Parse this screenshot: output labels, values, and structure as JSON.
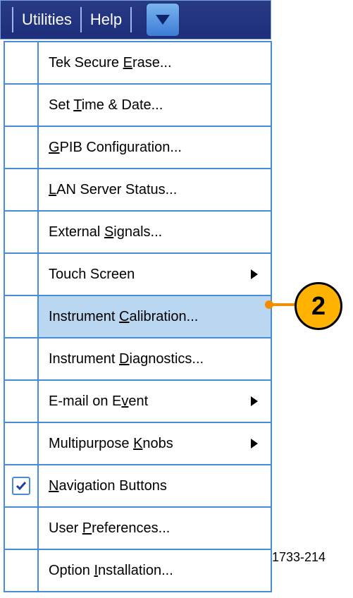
{
  "menubar": {
    "utilities_label": "Utilities",
    "help_label": "Help"
  },
  "menu_items": [
    {
      "id": "tek-secure-erase",
      "parts": [
        "Tek Secure ",
        "E",
        "rase..."
      ],
      "submenu": false,
      "checked": false,
      "highlight": false
    },
    {
      "id": "set-time-date",
      "parts": [
        "Set ",
        "T",
        "ime & Date..."
      ],
      "submenu": false,
      "checked": false,
      "highlight": false
    },
    {
      "id": "gpib-config",
      "parts": [
        "",
        "G",
        "PIB Configuration..."
      ],
      "submenu": false,
      "checked": false,
      "highlight": false
    },
    {
      "id": "lan-server-status",
      "parts": [
        "",
        "L",
        "AN Server Status..."
      ],
      "submenu": false,
      "checked": false,
      "highlight": false
    },
    {
      "id": "external-signals",
      "parts": [
        "External ",
        "S",
        "ignals..."
      ],
      "submenu": false,
      "checked": false,
      "highlight": false
    },
    {
      "id": "touch-screen",
      "parts": [
        "Touch Screen",
        "",
        ""
      ],
      "submenu": true,
      "checked": false,
      "highlight": false
    },
    {
      "id": "instrument-calibration",
      "parts": [
        "Instrument ",
        "C",
        "alibration..."
      ],
      "submenu": false,
      "checked": false,
      "highlight": true
    },
    {
      "id": "instrument-diagnostics",
      "parts": [
        "Instrument ",
        "D",
        "iagnostics..."
      ],
      "submenu": false,
      "checked": false,
      "highlight": false
    },
    {
      "id": "email-on-event",
      "parts": [
        "E-mail on E",
        "v",
        "ent"
      ],
      "submenu": true,
      "checked": false,
      "highlight": false
    },
    {
      "id": "multipurpose-knobs",
      "parts": [
        "Multipurpose ",
        "K",
        "nobs"
      ],
      "submenu": true,
      "checked": false,
      "highlight": false
    },
    {
      "id": "navigation-buttons",
      "parts": [
        "",
        "N",
        "avigation Buttons"
      ],
      "submenu": false,
      "checked": true,
      "highlight": false
    },
    {
      "id": "user-preferences",
      "parts": [
        "User ",
        "P",
        "references..."
      ],
      "submenu": false,
      "checked": false,
      "highlight": false
    },
    {
      "id": "option-installation",
      "parts": [
        "Option ",
        "I",
        "nstallation..."
      ],
      "submenu": false,
      "checked": false,
      "highlight": false
    }
  ],
  "callout": {
    "number": "2"
  },
  "figure_id": "1733-214"
}
